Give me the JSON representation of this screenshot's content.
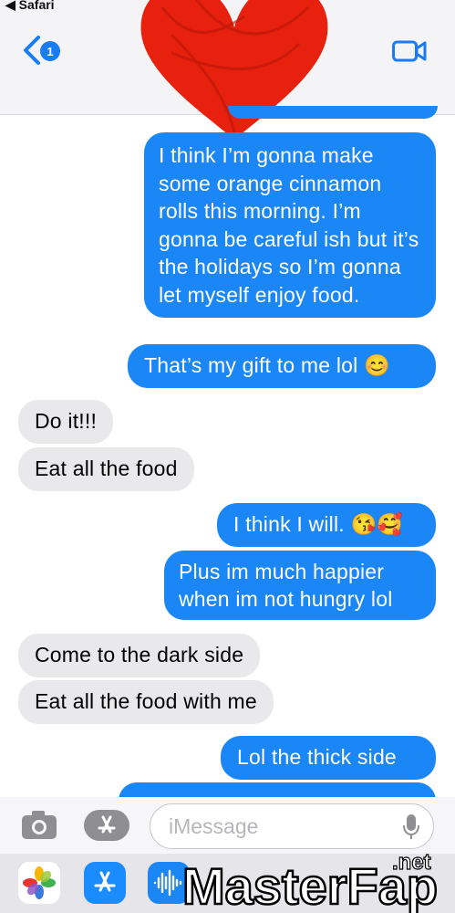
{
  "status": {
    "back_app": "◀ Safari"
  },
  "header": {
    "unread_count": "1"
  },
  "messages": [
    {
      "dir": "out",
      "text": "I think I’m gonna make some orange cinnamon rolls this morning. I’m gonna be careful ish but it’s the holidays so I’m gonna let myself enjoy food."
    },
    {
      "dir": "out",
      "text": "That’s my gift to me lol 😊"
    },
    {
      "dir": "in",
      "text": "Do it!!!"
    },
    {
      "dir": "in",
      "text": "Eat all the food"
    },
    {
      "dir": "out",
      "text": "I think I will. 😘🥰"
    },
    {
      "dir": "out",
      "text": "Plus im much happier when im not hungry lol"
    },
    {
      "dir": "in",
      "text": "Come to the dark side"
    },
    {
      "dir": "in",
      "text": "Eat all the food with me"
    },
    {
      "dir": "out",
      "text": "Lol the thick side"
    }
  ],
  "composer": {
    "placeholder": "iMessage"
  },
  "watermark": {
    "text": "MasterFap",
    "suffix": ".net"
  },
  "colors": {
    "outgoing": "#1b86f5",
    "incoming": "#e9e9eb",
    "heart": "#e8210f"
  }
}
